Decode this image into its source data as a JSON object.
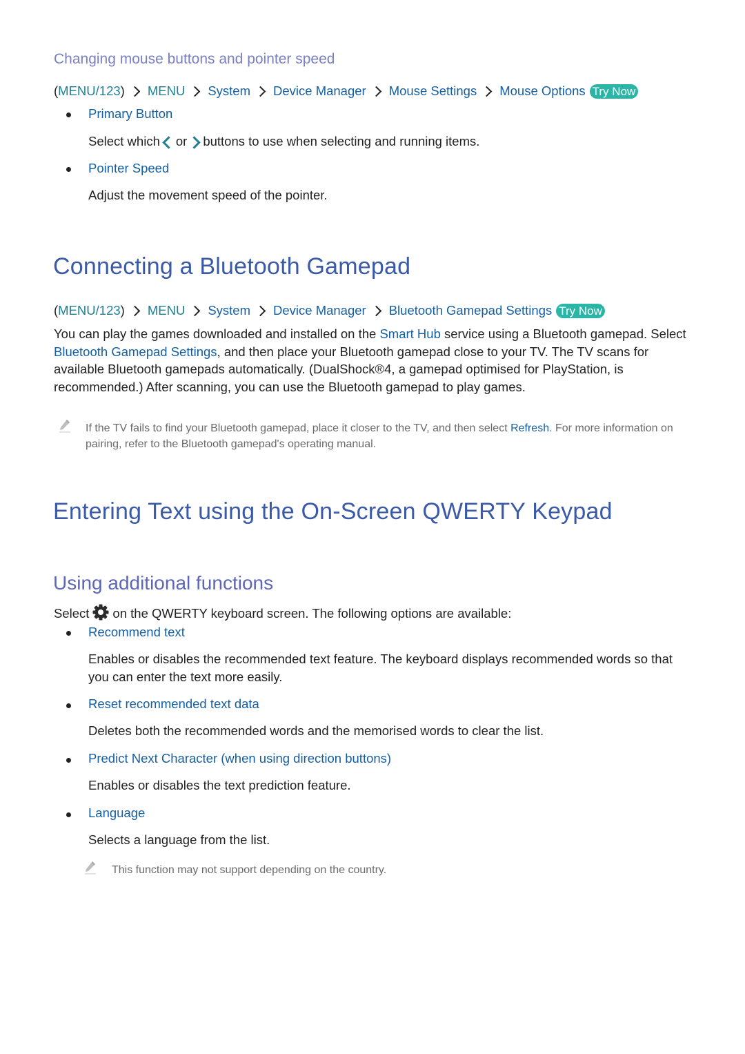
{
  "colors": {
    "subhead": "#7a7fc0",
    "heading": "#3a5aa8",
    "subheading": "#5d66b8",
    "link": "#155fa0",
    "teal": "#1f7f93",
    "try_now_bg": "#2bb5a7",
    "note_text": "#6a6a6a"
  },
  "mouse_section": {
    "title": "Changing mouse buttons and pointer speed",
    "breadcrumb": {
      "open_paren": "(",
      "root": "MENU/123",
      "close_paren": ")",
      "items": [
        "MENU",
        "System",
        "Device Manager",
        "Mouse Settings",
        "Mouse Options"
      ],
      "try_now": "Try Now"
    },
    "items": [
      {
        "label": "Primary Button",
        "desc_before": "Select which",
        "desc_middle": "or",
        "desc_after": "buttons to use when selecting and running items.",
        "icons": [
          "chevron-left-icon",
          "chevron-right-icon"
        ]
      },
      {
        "label": "Pointer Speed",
        "desc": "Adjust the movement speed of the pointer."
      }
    ]
  },
  "gamepad_section": {
    "title": "Connecting a Bluetooth Gamepad",
    "breadcrumb": {
      "open_paren": "(",
      "root": "MENU/123",
      "close_paren": ")",
      "items": [
        "MENU",
        "System",
        "Device Manager",
        "Bluetooth Gamepad Settings"
      ],
      "try_now": "Try Now"
    },
    "paragraph": {
      "p1": "You can play the games downloaded and installed on the ",
      "link1": "Smart Hub",
      "p2": " service using a Bluetooth gamepad. Select ",
      "link2": "Bluetooth Gamepad Settings",
      "p3": ", and then place your Bluetooth gamepad close to your TV. The TV scans for available Bluetooth gamepads automatically. (DualShock®4, a gamepad optimised for PlayStation, is recommended.) After scanning, you can use the Bluetooth gamepad to play games."
    },
    "note": {
      "icon": "pencil-icon",
      "t1": "If the TV fails to find your Bluetooth gamepad, place it closer to the TV, and then select ",
      "link": "Refresh",
      "t2": ". For more information on pairing, refer to the Bluetooth gamepad's operating manual."
    }
  },
  "qwerty_section": {
    "title": "Entering Text using the On-Screen QWERTY Keypad",
    "subtitle": "Using additional functions",
    "intro_before": "Select",
    "intro_icon": "gear-icon",
    "intro_after": "on the QWERTY keyboard screen. The following options are available:",
    "items": [
      {
        "label": "Recommend text",
        "desc": "Enables or disables the recommended text feature. The keyboard displays recommended words so that you can enter the text more easily."
      },
      {
        "label": "Reset recommended text data",
        "desc": "Deletes both the recommended words and the memorised words to clear the list."
      },
      {
        "label": "Predict Next Character (when using direction buttons)",
        "desc": "Enables or disables the text prediction feature."
      },
      {
        "label": "Language",
        "desc": "Selects a language from the list."
      }
    ],
    "note": {
      "icon": "pencil-icon",
      "text": "This function may not support depending on the country."
    }
  }
}
